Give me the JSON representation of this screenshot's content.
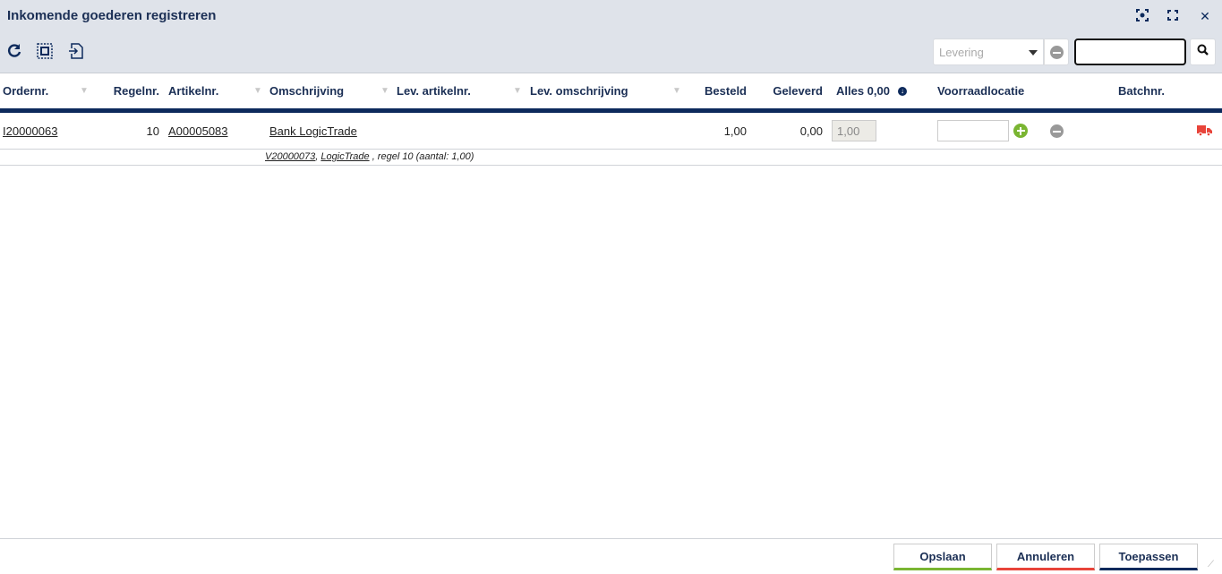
{
  "window": {
    "title": "Inkomende goederen registreren"
  },
  "filter": {
    "select_placeholder": "Levering",
    "search_value": ""
  },
  "columns": {
    "ordernr": "Ordernr.",
    "regelnr": "Regelnr.",
    "artikelnr": "Artikelnr.",
    "omschrijving": "Omschrijving",
    "lev_artikelnr": "Lev. artikelnr.",
    "lev_omschrijving": "Lev. omschrijving",
    "besteld": "Besteld",
    "geleverd": "Geleverd",
    "alles": "Alles 0,00",
    "voorraadlocatie": "Voorraadlocatie",
    "batchnr": "Batchnr."
  },
  "rows": [
    {
      "ordernr": "I20000063",
      "regelnr": "10",
      "artikelnr": "A00005083",
      "omschrijving": "Bank LogicTrade",
      "besteld": "1,00",
      "geleverd": "0,00",
      "qty": "1,00",
      "voorraadlocatie": "",
      "sub_order": "V20000073",
      "sub_sep": ",",
      "sub_supplier": "LogicTrade",
      "sub_text": ", regel 10 (aantal: 1,00)"
    }
  ],
  "buttons": {
    "save": "Opslaan",
    "cancel": "Annuleren",
    "apply": "Toepassen"
  },
  "colors": {
    "accent": "#0d2a5c",
    "save": "#7ab532",
    "cancel": "#e8443a"
  }
}
